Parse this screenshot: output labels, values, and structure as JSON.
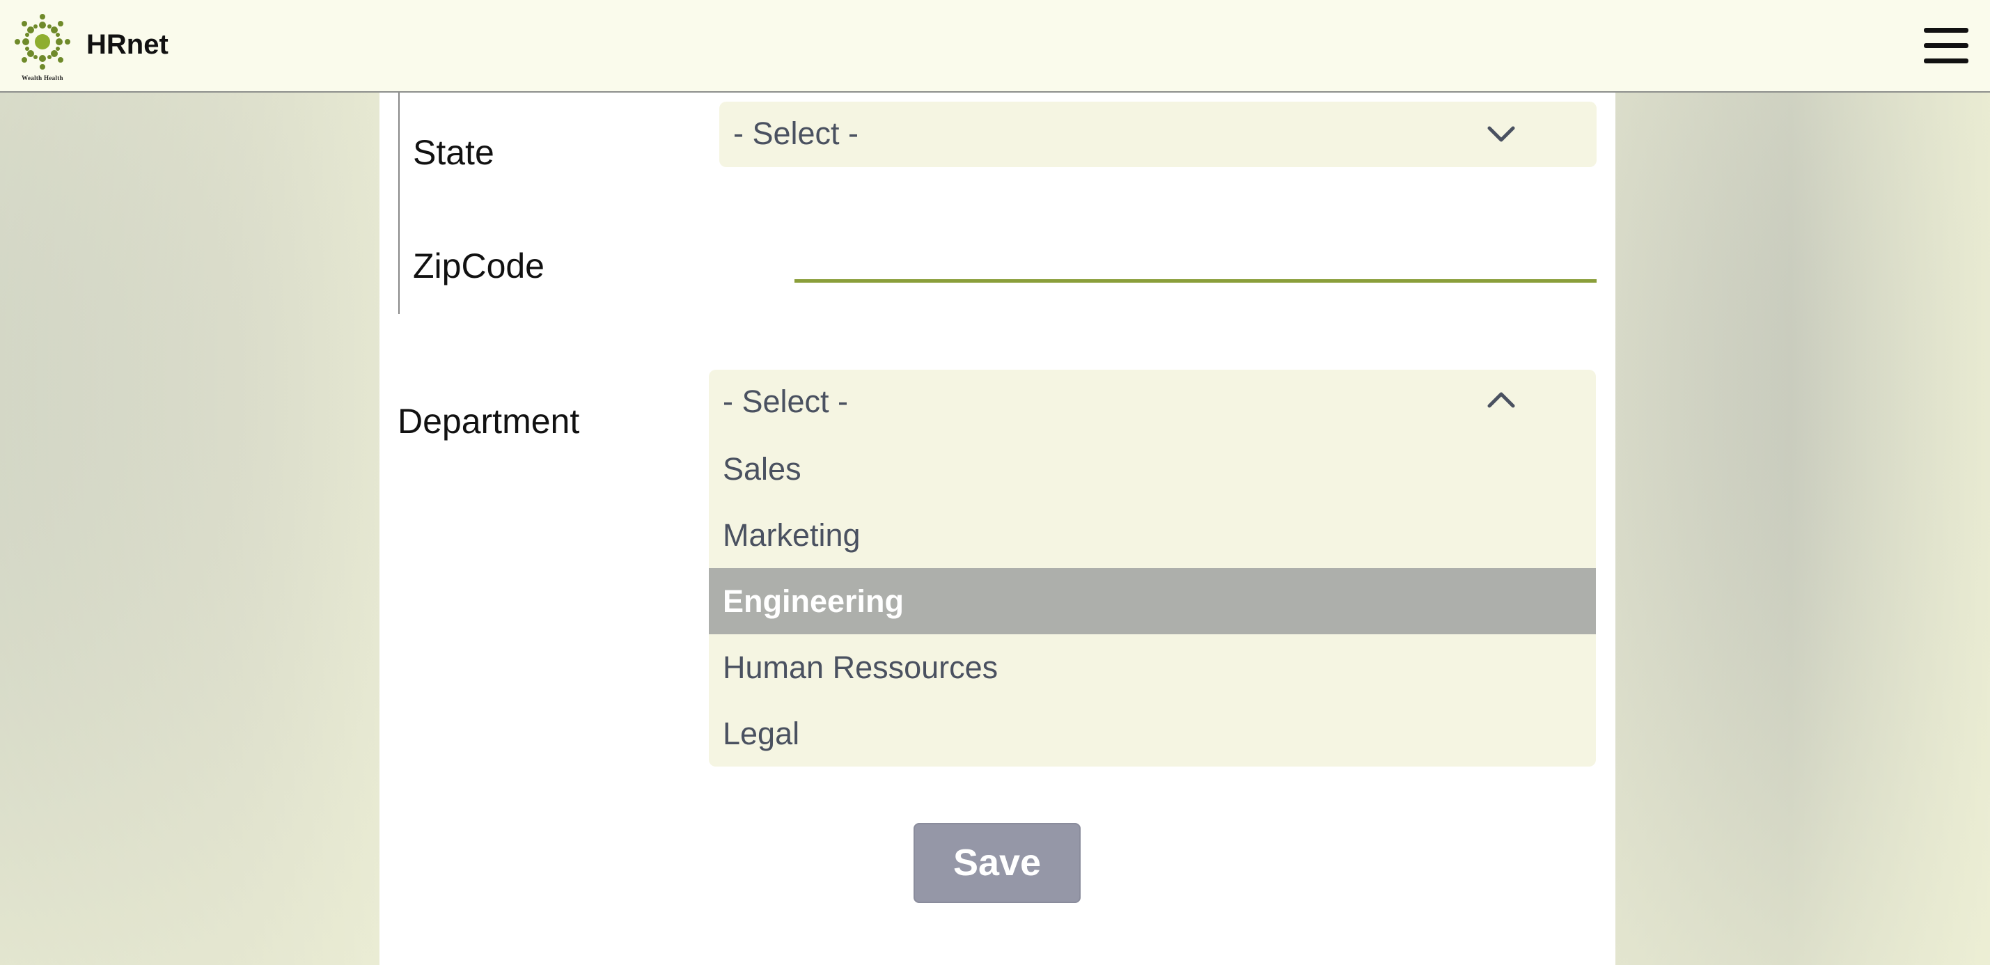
{
  "app": {
    "brand": "HRnet",
    "logo_caption": "Wealth Health",
    "logo_icon": "sunburst-logo-icon",
    "menu_icon": "hamburger-menu-icon"
  },
  "form": {
    "state": {
      "label": "State",
      "selected": "- Select -",
      "icon": "chevron-down-icon"
    },
    "zipcode": {
      "label": "ZipCode",
      "value": ""
    },
    "department": {
      "label": "Department",
      "selected": "- Select -",
      "icon": "chevron-up-icon",
      "options": [
        "Sales",
        "Marketing",
        "Engineering",
        "Human Ressources",
        "Legal"
      ],
      "highlighted": "Engineering"
    },
    "save_label": "Save"
  },
  "colors": {
    "accent": "#8a9e3a",
    "select_bg": "#f5f5e2",
    "highlight": "#adafab",
    "button": "#9597a7",
    "topbar": "#fafbec"
  }
}
